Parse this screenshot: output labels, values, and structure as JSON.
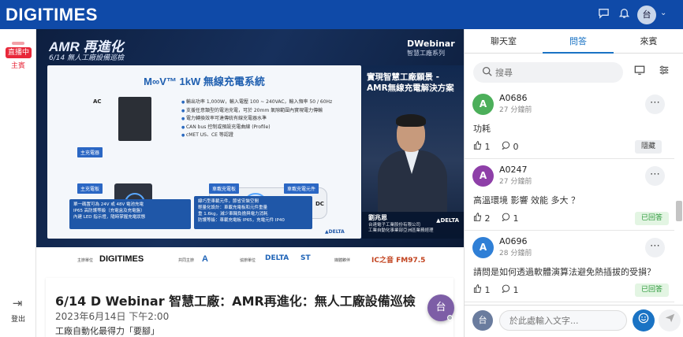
{
  "header": {
    "logo": "DIGITIMES",
    "chat_icon": "chat-bubble-icon",
    "bell_icon": "bell-icon",
    "avatar": "台",
    "chevron": "⌄"
  },
  "left_rail": {
    "live_label": "直播中",
    "role_label": "主賓",
    "exit_label": "登出",
    "exit_icon": "⇥"
  },
  "video": {
    "title": "AMR 再進化",
    "subtitle": "6/14 無人工廠設備巡檢",
    "brand": "DWebinar",
    "brand_sub": "智慧工廠系列",
    "slide": {
      "heading": "M∞V™ 1kW 無線充電系統",
      "bullets": [
        "輸出功率 1,000W，輸入電壓 100 ~ 240VAC，輸入頻率 50 / 60Hz",
        "支援任意類型的電池充電，可於 20mm 氣隙範圍內實現電力傳輸",
        "電力轉換效率可達傳統有線充電器水準",
        "CAN bus 控制或預設充電曲線 (Profile)",
        "cMET US、CE 等認證"
      ],
      "labels": {
        "ac": "AC",
        "dc": "DC"
      },
      "tags": [
        "主充電器",
        "主充電板",
        "車載充電板",
        "車載充電元件"
      ],
      "box_left": [
        "單一碼置可為 24V 或 48V 電池充電",
        "IP65 高防護等級（充電盒及充電盤）",
        "內建 LED 指示燈，隨時掌握充電狀態"
      ],
      "box_right": [
        "線巧型車載元件，節省安裝空間",
        "輕量化設計：車載充電板和元件重量",
        "重 1.6kg，減少車輛負擔與電力消耗",
        "防護等級：車載充電板 IP65，充電元件 IP40"
      ],
      "footer": "▲DELTA"
    },
    "presenter": {
      "title": "實現智慧工廠願景 - AMR無線充電解決方案",
      "name": "劉兆恩",
      "company_line1": "台達電子工業股份有限公司",
      "company_line2": "工業自動化事業部亞洲區業務經理",
      "delta": "▲DELTA"
    }
  },
  "sponsors": {
    "organizer_label": "主辦單位",
    "organizer": "DIGITIMES",
    "co_label": "共同主辦",
    "co_logo": "A",
    "assist_label": "協辦單位",
    "assist_1": "DELTA",
    "assist_2": "ST",
    "media_label": "媒體夥伴",
    "media": "IC之音 FM97.5"
  },
  "event": {
    "title": "6/14 D Webinar 智慧工廠：AMR再進化：無人工廠設備巡檢",
    "date": "2023年6月14日 下午2:00",
    "desc": "工廠自動化最得力「要腳」",
    "fab": "台"
  },
  "panel": {
    "tabs": [
      {
        "label": "聊天室",
        "active": false
      },
      {
        "label": "問答",
        "active": true
      },
      {
        "label": "來賓",
        "active": false
      }
    ],
    "search_placeholder": "搜尋",
    "screen_icon": "screen-share-icon",
    "filter_icon": "filter-icon",
    "questions": [
      {
        "avatar": "A",
        "avatar_color": "#4caf5a",
        "id": "A0686",
        "time": "27 分鐘前",
        "text": "功耗",
        "likes": "1",
        "replies": "0",
        "status": "隱藏",
        "status_type": "hidden"
      },
      {
        "avatar": "A",
        "avatar_color": "#8e3fa8",
        "id": "A0247",
        "time": "27 分鐘前",
        "text": "高溫環境 影響 效能 多大 ？",
        "likes": "2",
        "replies": "1",
        "status": "已回答",
        "status_type": "answered"
      },
      {
        "avatar": "A",
        "avatar_color": "#2f7fd6",
        "id": "A0696",
        "time": "28 分鐘前",
        "text": "請問是如何透過軟體演算法避免熱插拔的受損？",
        "likes": "1",
        "replies": "1",
        "status": "已回答",
        "status_type": "answered"
      }
    ],
    "composer": {
      "avatar": "台",
      "placeholder": "於此處輸入文字..."
    }
  },
  "colors": {
    "brand_blue": "#0f4aa8",
    "live_red": "#e8283a",
    "accent_blue": "#1a73c4",
    "answered_green": "#2e9a3c"
  }
}
